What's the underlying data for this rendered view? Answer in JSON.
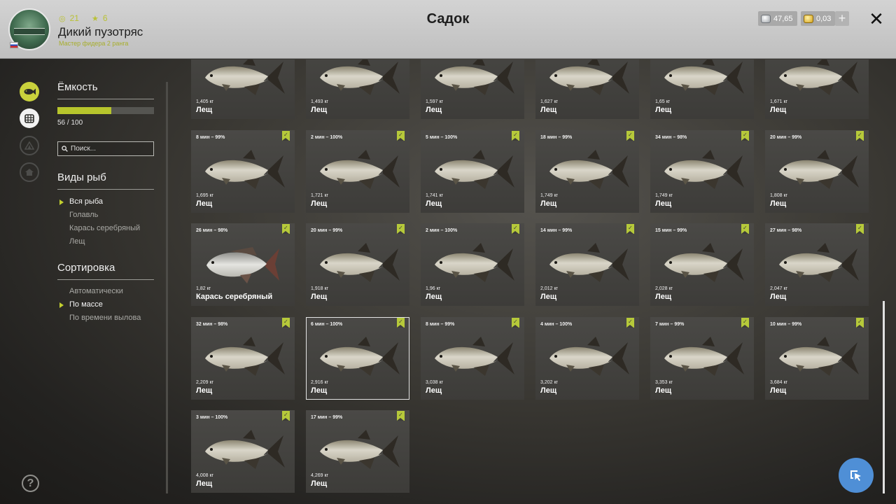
{
  "header": {
    "title": "Садок",
    "player": {
      "coins": "21",
      "stars": "6",
      "name": "Дикий пузотряс",
      "rank": "Мастер фидера 2 ранга"
    },
    "currency": {
      "silver": "47,65",
      "gold": "0,03"
    },
    "plus_label": "+",
    "close_label": "✕"
  },
  "capacity": {
    "title": "Ёмкость",
    "used": 56,
    "total": 100,
    "text": "56 / 100"
  },
  "search": {
    "placeholder": "Поиск..."
  },
  "species": {
    "title": "Виды рыб",
    "items": [
      {
        "label": "Вся рыба",
        "active": true
      },
      {
        "label": "Голавль",
        "active": false
      },
      {
        "label": "Карась серебряный",
        "active": false
      },
      {
        "label": "Лещ",
        "active": false
      }
    ]
  },
  "sorting": {
    "title": "Сортировка",
    "items": [
      {
        "label": "Автоматически",
        "active": false
      },
      {
        "label": "По массе",
        "active": true
      },
      {
        "label": "По времени вылова",
        "active": false
      }
    ]
  },
  "help_label": "?",
  "colors": {
    "accent": "#c2cf2f",
    "panel": "#4a4946",
    "blue": "#4f8fd6"
  },
  "fish": [
    {
      "time": "",
      "weight": "1,405 кг",
      "name": "Лещ",
      "check": false,
      "type": "bream"
    },
    {
      "time": "",
      "weight": "1,493 кг",
      "name": "Лещ",
      "check": false,
      "type": "bream"
    },
    {
      "time": "",
      "weight": "1,597 кг",
      "name": "Лещ",
      "check": false,
      "type": "bream"
    },
    {
      "time": "",
      "weight": "1,627 кг",
      "name": "Лещ",
      "check": false,
      "type": "bream"
    },
    {
      "time": "",
      "weight": "1,65 кг",
      "name": "Лещ",
      "check": false,
      "type": "bream"
    },
    {
      "time": "",
      "weight": "1,671 кг",
      "name": "Лещ",
      "check": false,
      "type": "bream"
    },
    {
      "time": "8 мин – 99%",
      "weight": "1,695 кг",
      "name": "Лещ",
      "check": true,
      "type": "bream"
    },
    {
      "time": "2 мин – 100%",
      "weight": "1,721 кг",
      "name": "Лещ",
      "check": true,
      "type": "bream"
    },
    {
      "time": "5 мин – 100%",
      "weight": "1,741 кг",
      "name": "Лещ",
      "check": true,
      "type": "bream"
    },
    {
      "time": "18 мин – 99%",
      "weight": "1,749 кг",
      "name": "Лещ",
      "check": true,
      "type": "bream"
    },
    {
      "time": "34 мин – 98%",
      "weight": "1,749 кг",
      "name": "Лещ",
      "check": true,
      "type": "bream"
    },
    {
      "time": "20 мин – 99%",
      "weight": "1,808 кг",
      "name": "Лещ",
      "check": true,
      "type": "bream"
    },
    {
      "time": "26 мин – 98%",
      "weight": "1,82 кг",
      "name": "Карась серебряный",
      "check": true,
      "type": "carp"
    },
    {
      "time": "20 мин – 99%",
      "weight": "1,918 кг",
      "name": "Лещ",
      "check": true,
      "type": "bream"
    },
    {
      "time": "2 мин – 100%",
      "weight": "1,96 кг",
      "name": "Лещ",
      "check": true,
      "type": "bream"
    },
    {
      "time": "14 мин – 99%",
      "weight": "2,012 кг",
      "name": "Лещ",
      "check": true,
      "type": "bream"
    },
    {
      "time": "15 мин – 99%",
      "weight": "2,028 кг",
      "name": "Лещ",
      "check": true,
      "type": "bream"
    },
    {
      "time": "27 мин – 98%",
      "weight": "2,047 кг",
      "name": "Лещ",
      "check": true,
      "type": "bream"
    },
    {
      "time": "32 мин – 98%",
      "weight": "2,209 кг",
      "name": "Лещ",
      "check": true,
      "type": "bream"
    },
    {
      "time": "6 мин – 100%",
      "weight": "2,916 кг",
      "name": "Лещ",
      "check": true,
      "type": "bream",
      "selected": true
    },
    {
      "time": "8 мин – 99%",
      "weight": "3,038 кг",
      "name": "Лещ",
      "check": true,
      "type": "bream"
    },
    {
      "time": "4 мин – 100%",
      "weight": "3,202 кг",
      "name": "Лещ",
      "check": true,
      "type": "bream"
    },
    {
      "time": "7 мин – 99%",
      "weight": "3,353 кг",
      "name": "Лещ",
      "check": true,
      "type": "bream"
    },
    {
      "time": "10 мин – 99%",
      "weight": "3,684 кг",
      "name": "Лещ",
      "check": true,
      "type": "bream"
    },
    {
      "time": "3 мин – 100%",
      "weight": "4,008 кг",
      "name": "Лещ",
      "check": true,
      "type": "bream"
    },
    {
      "time": "17 мин – 99%",
      "weight": "4,269 кг",
      "name": "Лещ",
      "check": true,
      "type": "bream"
    }
  ]
}
